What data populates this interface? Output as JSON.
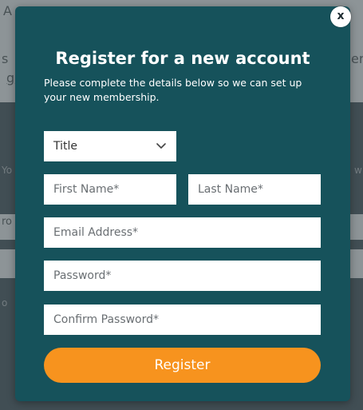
{
  "background": {
    "fragments": [
      "A",
      "s",
      "g",
      "Yo",
      "ro",
      "o",
      "er",
      "w"
    ]
  },
  "modal": {
    "close_label": "x",
    "title": "Register for a new account",
    "intro": "Please complete the details below so we can set up your new membership.",
    "title_select": {
      "selected": "Title"
    },
    "fields": {
      "first_name_placeholder": "First Name*",
      "last_name_placeholder": "Last Name*",
      "email_placeholder": "Email Address*",
      "password_placeholder": "Password*",
      "confirm_password_placeholder": "Confirm Password*"
    },
    "register_label": "Register"
  },
  "colors": {
    "modal_bg": "#16525b",
    "button_bg": "#f7931e",
    "field_bg": "#ffffff"
  },
  "icons": {
    "close": "close-icon",
    "select": "chevron-down-icon"
  }
}
